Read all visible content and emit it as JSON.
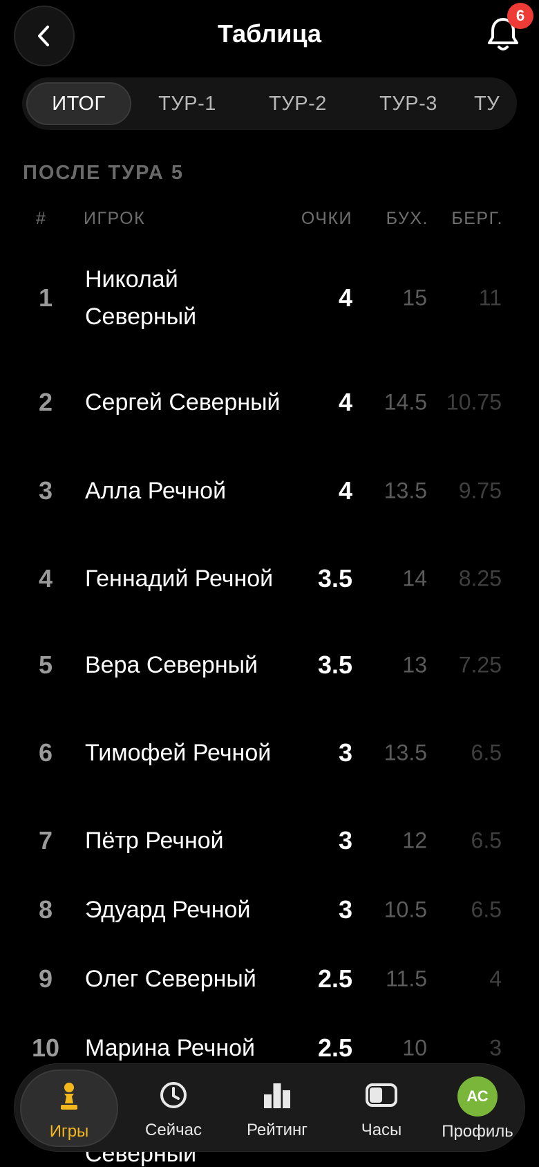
{
  "header": {
    "title": "Таблица",
    "notifications_count": "6"
  },
  "tabs": [
    "ИТОГ",
    "ТУР-1",
    "ТУР-2",
    "ТУР-3",
    "ТУ"
  ],
  "section": {
    "title": "ПОСЛЕ ТУРА 5"
  },
  "columns": {
    "num": "#",
    "player": "ИГРОК",
    "points": "ОЧКИ",
    "buchholz": "БУХ.",
    "berger": "БЕРГ."
  },
  "rows": [
    {
      "rank": "1",
      "name": "Николай Северный",
      "points": "4",
      "buchholz": "15",
      "berger": "11"
    },
    {
      "rank": "2",
      "name": "Сергей Северный",
      "points": "4",
      "buchholz": "14.5",
      "berger": "10.75"
    },
    {
      "rank": "3",
      "name": "Алла Речной",
      "points": "4",
      "buchholz": "13.5",
      "berger": "9.75"
    },
    {
      "rank": "4",
      "name": "Геннадий Речной",
      "points": "3.5",
      "buchholz": "14",
      "berger": "8.25"
    },
    {
      "rank": "5",
      "name": "Вера Северный",
      "points": "3.5",
      "buchholz": "13",
      "berger": "7.25"
    },
    {
      "rank": "6",
      "name": "Тимофей Речной",
      "points": "3",
      "buchholz": "13.5",
      "berger": "6.5"
    },
    {
      "rank": "7",
      "name": "Пётр Речной",
      "points": "3",
      "buchholz": "12",
      "berger": "6.5"
    },
    {
      "rank": "8",
      "name": "Эдуард Речной",
      "points": "3",
      "buchholz": "10.5",
      "berger": "6.5"
    },
    {
      "rank": "9",
      "name": "Олег Северный",
      "points": "2.5",
      "buchholz": "11.5",
      "berger": "4"
    },
    {
      "rank": "10",
      "name": "Марина Речной",
      "points": "2.5",
      "buchholz": "10",
      "berger": "3"
    }
  ],
  "peek_text": "Северный",
  "nav": [
    {
      "label": "Игры",
      "icon": "pawn-icon",
      "active": true
    },
    {
      "label": "Сейчас",
      "icon": "clock-icon"
    },
    {
      "label": "Рейтинг",
      "icon": "bar-chart-icon"
    },
    {
      "label": "Часы",
      "icon": "chess-clock-icon"
    },
    {
      "label": "Профиль",
      "icon": "avatar",
      "initials": "АС"
    }
  ],
  "colors": {
    "accent": "#f5b81c",
    "badge": "#ef3b36",
    "avatar": "#7ab63a",
    "background": "#000000"
  }
}
